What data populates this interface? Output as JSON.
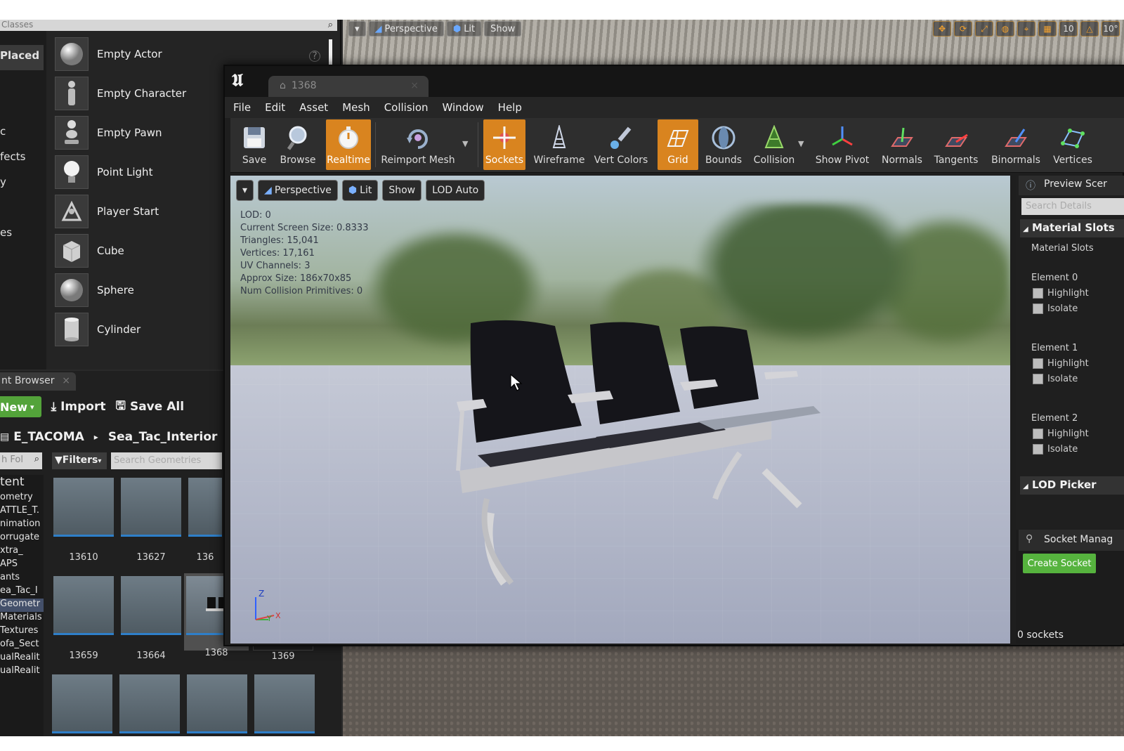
{
  "bg_editor": {
    "viewport_buttons": [
      "Perspective",
      "Lit",
      "Show"
    ],
    "tool_numbers": [
      "10",
      "10°"
    ]
  },
  "place_panel": {
    "search_placeholder": "Classes",
    "category_active": "Placed",
    "categories": [
      "c",
      "fects",
      "y",
      "es"
    ],
    "items": [
      {
        "label": "Empty Actor",
        "icon": "sphere-icon"
      },
      {
        "label": "Empty Character",
        "icon": "character-icon"
      },
      {
        "label": "Empty Pawn",
        "icon": "pawn-icon"
      },
      {
        "label": "Point Light",
        "icon": "light-bulb-icon"
      },
      {
        "label": "Player Start",
        "icon": "player-start-icon"
      },
      {
        "label": "Cube",
        "icon": "cube-icon"
      },
      {
        "label": "Sphere",
        "icon": "sphere-icon"
      },
      {
        "label": "Cylinder",
        "icon": "cylinder-icon"
      }
    ]
  },
  "content_browser": {
    "tab_label": "nt Browser",
    "new_label": "New",
    "import_label": "Import",
    "save_all_label": "Save All",
    "path": [
      "E_TACOMA",
      "Sea_Tac_Interior"
    ],
    "folder_search_placeholder": "h Fol",
    "filters_label": "Filters",
    "asset_search_placeholder": "Search Geometries",
    "tree": [
      "tent",
      "ometry",
      "ATTLE_T.",
      "nimation",
      "orrugate",
      "xtra_",
      "APS",
      "ants",
      "ea_Tac_I",
      "Geometr",
      "Materials",
      "Textures",
      "ofa_Sect",
      "ualRealit",
      "ualRealit"
    ],
    "tiles": [
      "13610",
      "13627",
      "136",
      "13659",
      "13664",
      "1368",
      "1369"
    ]
  },
  "mesh_editor": {
    "tab_title": "1368",
    "menu": [
      "File",
      "Edit",
      "Asset",
      "Mesh",
      "Collision",
      "Window",
      "Help"
    ],
    "toolbar": {
      "save": "Save",
      "browse": "Browse",
      "realtime": "Realtime",
      "reimport": "Reimport Mesh",
      "sockets": "Sockets",
      "wireframe": "Wireframe",
      "vert_colors": "Vert Colors",
      "grid": "Grid",
      "bounds": "Bounds",
      "collision": "Collision",
      "show_pivot": "Show Pivot",
      "normals": "Normals",
      "tangents": "Tangents",
      "binormals": "Binormals",
      "vertices": "Vertices"
    },
    "viewport": {
      "perspective": "Perspective",
      "lit": "Lit",
      "show": "Show",
      "lod": "LOD Auto",
      "stats": [
        "LOD:  0",
        "Current Screen Size:  0.8333",
        "Triangles:  15,041",
        "Vertices:  17,161",
        "UV Channels:  3",
        "Approx Size: 186x70x85",
        "Num Collision Primitives:  0"
      ],
      "axis_z": "Z",
      "axis_y": "Y",
      "axis_x": "X"
    },
    "details": {
      "tab": "Preview Scer",
      "search_placeholder": "Search Details",
      "material_section": "Material Slots",
      "material_label": "Material Slots",
      "elements": [
        {
          "name": "Element 0",
          "highlight": "Highlight",
          "isolate": "Isolate"
        },
        {
          "name": "Element 1",
          "highlight": "Highlight",
          "isolate": "Isolate"
        },
        {
          "name": "Element 2",
          "highlight": "Highlight",
          "isolate": "Isolate"
        }
      ],
      "lod_section": "LOD Picker"
    },
    "sockets": {
      "tab": "Socket Manag",
      "create": "Create Socket",
      "count": "0 sockets"
    }
  },
  "colors": {
    "accent_orange": "#d9841f",
    "green_button": "#56b33e",
    "selection_blue": "#2e7fc9"
  }
}
